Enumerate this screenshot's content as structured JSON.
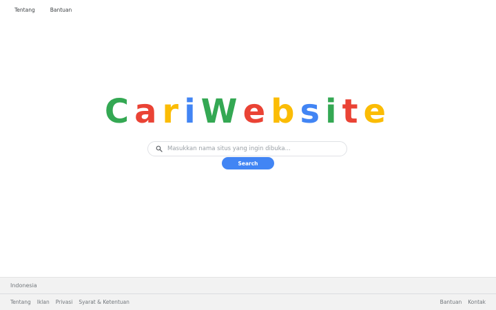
{
  "top_nav": {
    "about": "Tentang",
    "help": "Bantuan"
  },
  "logo": {
    "letters": [
      {
        "char": "C",
        "color": "#34a853"
      },
      {
        "char": "a",
        "color": "#ea4335"
      },
      {
        "char": "r",
        "color": "#fbbc05"
      },
      {
        "char": "i",
        "color": "#4285f4"
      },
      {
        "char": "W",
        "color": "#34a853"
      },
      {
        "char": "e",
        "color": "#ea4335"
      },
      {
        "char": "b",
        "color": "#fbbc05"
      },
      {
        "char": "s",
        "color": "#4285f4"
      },
      {
        "char": "i",
        "color": "#34a853"
      },
      {
        "char": "t",
        "color": "#ea4335"
      },
      {
        "char": "e",
        "color": "#fbbc05"
      }
    ]
  },
  "search": {
    "placeholder": "Masukkan nama situs yang ingin dibuka...",
    "value": "",
    "button_label": "Search",
    "icon": "search-icon"
  },
  "footer": {
    "country": "Indonesia",
    "left_links": [
      "Tentang",
      "Iklan",
      "Privasi",
      "Syarat & Ketentuan"
    ],
    "right_links": [
      "Bantuan",
      "Kontak"
    ]
  },
  "colors": {
    "accent": "#4285f4",
    "footer_bg": "#f2f2f2"
  }
}
